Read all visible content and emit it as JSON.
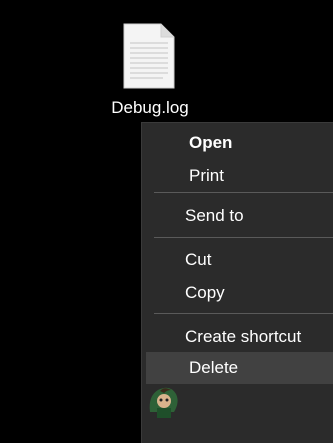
{
  "desktop": {
    "file": {
      "name": "Debug.log",
      "icon": "text-file-icon"
    }
  },
  "context_menu": {
    "items": [
      {
        "label": "Open",
        "default": true
      },
      {
        "label": "Print"
      },
      {
        "label": "Send to"
      },
      {
        "label": "Cut"
      },
      {
        "label": "Copy"
      },
      {
        "label": "Create shortcut"
      },
      {
        "label": "Delete",
        "highlighted": true
      }
    ],
    "colors": {
      "background": "#2b2b2b",
      "highlight": "#414141",
      "separator": "#5a5a5a"
    }
  },
  "watermark": {
    "icon": "appuals-mascot-logo"
  }
}
